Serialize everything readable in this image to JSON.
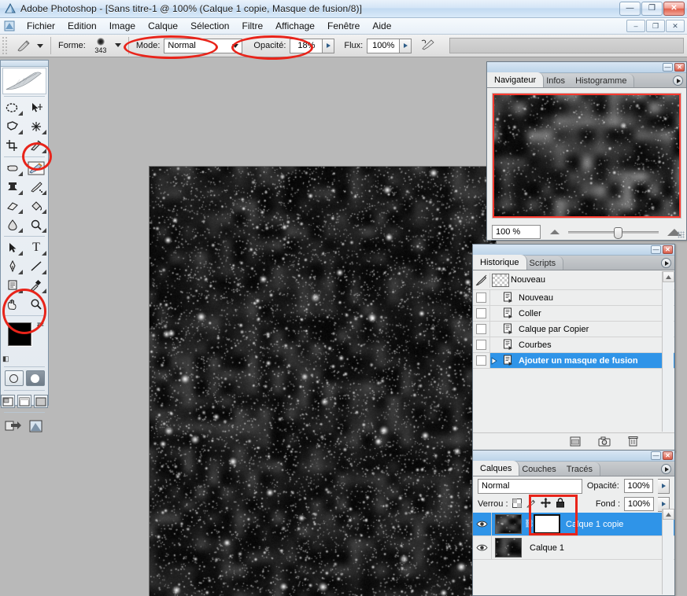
{
  "window": {
    "app_title": "Adobe Photoshop - [Sans titre-1 @ 100% (Calque 1 copie, Masque de fusion/8)]",
    "minimize": "—",
    "restore": "❐",
    "close": "✕",
    "doc_minimize": "–",
    "doc_restore": "❐",
    "doc_close": "✕"
  },
  "menu": {
    "items": [
      {
        "label": "Fichier"
      },
      {
        "label": "Edition"
      },
      {
        "label": "Image"
      },
      {
        "label": "Calque"
      },
      {
        "label": "Sélection"
      },
      {
        "label": "Filtre"
      },
      {
        "label": "Affichage"
      },
      {
        "label": "Fenêtre"
      },
      {
        "label": "Aide"
      }
    ]
  },
  "options_bar": {
    "forme_label": "Forme:",
    "brush_size": "343",
    "mode_label": "Mode:",
    "mode_value": "Normal",
    "opacity_label": "Opacité:",
    "opacity_value": "18%",
    "flux_label": "Flux:",
    "flux_value": "100%",
    "airbrush_icon": "airbrush-icon"
  },
  "toolbar": {
    "tools": [
      {
        "name": "rectangular-marquee-tool",
        "glyph": "◯"
      },
      {
        "name": "move-tool",
        "glyph": "➤"
      },
      {
        "name": "lasso-tool",
        "glyph": "❀"
      },
      {
        "name": "magic-wand-tool",
        "glyph": "✳"
      },
      {
        "name": "crop-tool",
        "glyph": "⌗"
      },
      {
        "name": "slice-tool",
        "glyph": "✂"
      },
      {
        "name": "healing-brush-tool",
        "glyph": "✒"
      },
      {
        "name": "brush-tool",
        "glyph": "✎"
      },
      {
        "name": "clone-stamp-tool",
        "glyph": "✇"
      },
      {
        "name": "history-brush-tool",
        "glyph": "✐"
      },
      {
        "name": "eraser-tool",
        "glyph": "▱"
      },
      {
        "name": "gradient-paint-bucket-tool",
        "glyph": "◩"
      },
      {
        "name": "blur-tool",
        "glyph": "◖"
      },
      {
        "name": "dodge-tool",
        "glyph": "◍"
      },
      {
        "name": "path-selection-tool",
        "glyph": "➤"
      },
      {
        "name": "type-tool",
        "glyph": "T"
      },
      {
        "name": "pen-tool",
        "glyph": "✑"
      },
      {
        "name": "line-shape-tool",
        "glyph": "╲"
      },
      {
        "name": "notes-tool",
        "glyph": "☰"
      },
      {
        "name": "eyedropper-tool",
        "glyph": "⚗"
      },
      {
        "name": "hand-tool",
        "glyph": "✋"
      },
      {
        "name": "zoom-tool",
        "glyph": "⚲"
      }
    ],
    "foreground_color": "#000000",
    "background_color": "#ffffff",
    "selected_tool": "brush-tool",
    "quickmask_off": "standard-mode-button",
    "quickmask_on": "quick-mask-mode-button",
    "screen_modes": [
      "standard-screen-mode",
      "full-screen-menubar-mode",
      "full-screen-mode"
    ],
    "jump_to_imageready": "jump-to-imageready-button"
  },
  "navigator": {
    "tabs": [
      {
        "label": "Navigateur",
        "active": true
      },
      {
        "label": "Infos",
        "active": false
      },
      {
        "label": "Histogramme",
        "active": false
      }
    ],
    "zoom_value": "100 %",
    "view_box_color": "#ff3b30"
  },
  "history": {
    "tabs": [
      {
        "label": "Historique",
        "active": true
      },
      {
        "label": "Scripts",
        "active": false
      }
    ],
    "snapshot": "Nouveau",
    "states": [
      {
        "label": "Nouveau",
        "selected": false
      },
      {
        "label": "Coller",
        "selected": false
      },
      {
        "label": "Calque par Copier",
        "selected": false
      },
      {
        "label": "Courbes",
        "selected": false
      },
      {
        "label": "Ajouter un masque de fusion",
        "selected": true
      }
    ],
    "footer_buttons": [
      {
        "name": "create-document-from-state-icon"
      },
      {
        "name": "create-snapshot-icon"
      },
      {
        "name": "delete-state-icon"
      }
    ]
  },
  "layers": {
    "tabs": [
      {
        "label": "Calques",
        "active": true
      },
      {
        "label": "Couches",
        "active": false
      },
      {
        "label": "Tracés",
        "active": false
      }
    ],
    "blend_mode": "Normal",
    "opacity_label": "Opacité:",
    "opacity_value": "100%",
    "lock_label": "Verrou :",
    "fill_label": "Fond :",
    "fill_value": "100%",
    "lock_icons": [
      {
        "name": "lock-transparent-pixels-icon"
      },
      {
        "name": "lock-image-pixels-icon"
      },
      {
        "name": "lock-position-icon"
      },
      {
        "name": "lock-all-icon"
      }
    ],
    "items": [
      {
        "name": "Calque 1 copie",
        "selected": true,
        "has_mask": true,
        "visible": true
      },
      {
        "name": "Calque 1",
        "selected": false,
        "has_mask": false,
        "visible": true
      }
    ]
  },
  "annotations": {
    "color": "#e8241a",
    "marks": [
      {
        "name": "annotation-mode-ellipse",
        "shape": "ellipse"
      },
      {
        "name": "annotation-opacity-ellipse",
        "shape": "ellipse"
      },
      {
        "name": "annotation-brush-tool-ellipse",
        "shape": "ellipse"
      },
      {
        "name": "annotation-foreground-color-ellipse",
        "shape": "ellipse"
      },
      {
        "name": "annotation-lock-icons-rect",
        "shape": "rect"
      },
      {
        "name": "annotation-layer-mask-rect",
        "shape": "rect"
      }
    ]
  }
}
